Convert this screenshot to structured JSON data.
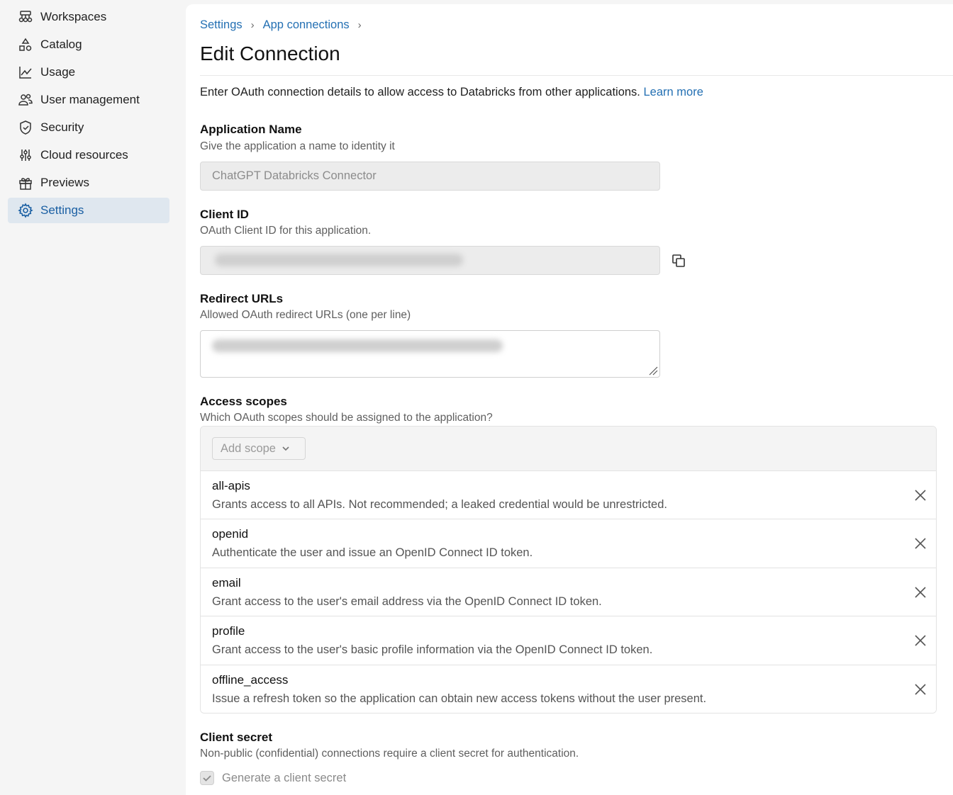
{
  "sidebar": {
    "items": [
      {
        "label": "Workspaces",
        "icon": "workspaces-icon"
      },
      {
        "label": "Catalog",
        "icon": "catalog-icon"
      },
      {
        "label": "Usage",
        "icon": "usage-chart-icon"
      },
      {
        "label": "User management",
        "icon": "users-icon"
      },
      {
        "label": "Security",
        "icon": "shield-icon"
      },
      {
        "label": "Cloud resources",
        "icon": "sliders-icon"
      },
      {
        "label": "Previews",
        "icon": "gift-icon"
      },
      {
        "label": "Settings",
        "icon": "gear-icon",
        "active": true
      }
    ]
  },
  "breadcrumb": {
    "items": [
      "Settings",
      "App connections"
    ]
  },
  "page": {
    "title": "Edit Connection",
    "intro": "Enter OAuth connection details to allow access to Databricks from other applications.",
    "learn_more": "Learn more"
  },
  "form": {
    "app_name": {
      "label": "Application Name",
      "hint": "Give the application a name to identity it",
      "value": "ChatGPT Databricks Connector"
    },
    "client_id": {
      "label": "Client ID",
      "hint": "OAuth Client ID for this application."
    },
    "redirect_urls": {
      "label": "Redirect URLs",
      "hint": "Allowed OAuth redirect URLs (one per line)"
    },
    "access_scopes": {
      "label": "Access scopes",
      "hint": "Which OAuth scopes should be assigned to the application?",
      "add_scope": "Add scope",
      "scopes": [
        {
          "name": "all-apis",
          "desc": "Grants access to all APIs. Not recommended; a leaked credential would be unrestricted."
        },
        {
          "name": "openid",
          "desc": "Authenticate the user and issue an OpenID Connect ID token."
        },
        {
          "name": "email",
          "desc": "Grant access to the user's email address via the OpenID Connect ID token."
        },
        {
          "name": "profile",
          "desc": "Grant access to the user's basic profile information via the OpenID Connect ID token."
        },
        {
          "name": "offline_access",
          "desc": "Issue a refresh token so the application can obtain new access tokens without the user present."
        }
      ]
    },
    "client_secret": {
      "label": "Client secret",
      "hint": "Non-public (confidential) connections require a client secret for authentication.",
      "checkbox_label": "Generate a client secret",
      "checked": true
    }
  },
  "colors": {
    "accent": "#2470b3",
    "active_bg": "#dfe7ef"
  }
}
